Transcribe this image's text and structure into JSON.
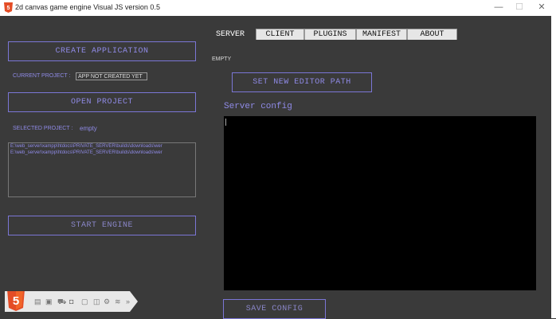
{
  "window": {
    "title": "2d canvas game engine Visual JS version 0.5",
    "min_glyph": "—",
    "max_glyph": "☐",
    "close_glyph": "✕"
  },
  "left_panel": {
    "create_application": "CREATE APPLICATION",
    "current_project_label": "CURRENT PROJECT :",
    "current_project_value": "APP NOT CREATED YET",
    "open_project": "OPEN PROJECT",
    "selected_project_label": "SELECTED PROJECT :",
    "selected_project_value": "empty",
    "paths": [
      "E:\\web_server\\xampp\\htdocs\\PRIVATE_SERVER\\builds\\downloads\\wer",
      "E:\\web_server\\xampp\\htdocs\\PRIVATE_SERVER\\builds\\downloads\\wer"
    ],
    "start_engine": "START ENGINE"
  },
  "footer": {
    "logo_text": "5",
    "icons": [
      "file-icon",
      "device-icon",
      "car-icon",
      "bot-icon",
      "ui-icon",
      "box-icon",
      "gear-icon",
      "wave-icon",
      "chevron-icon"
    ]
  },
  "tabs": [
    {
      "label": "SERVER",
      "active": true
    },
    {
      "label": "CLIENT",
      "active": false
    },
    {
      "label": "PLUGINS",
      "active": false
    },
    {
      "label": "MANIFEST",
      "active": false
    },
    {
      "label": "ABOUT",
      "active": false
    }
  ],
  "server_tab": {
    "status": "EMPTY",
    "set_editor_path": "SET NEW EDITOR PATH",
    "server_config_label": "Server config",
    "console_text": "",
    "save_config": "SAVE CONFIG"
  },
  "colors": {
    "background": "#3a3a3a",
    "accent": "#8f8ae6",
    "console": "#000000"
  }
}
